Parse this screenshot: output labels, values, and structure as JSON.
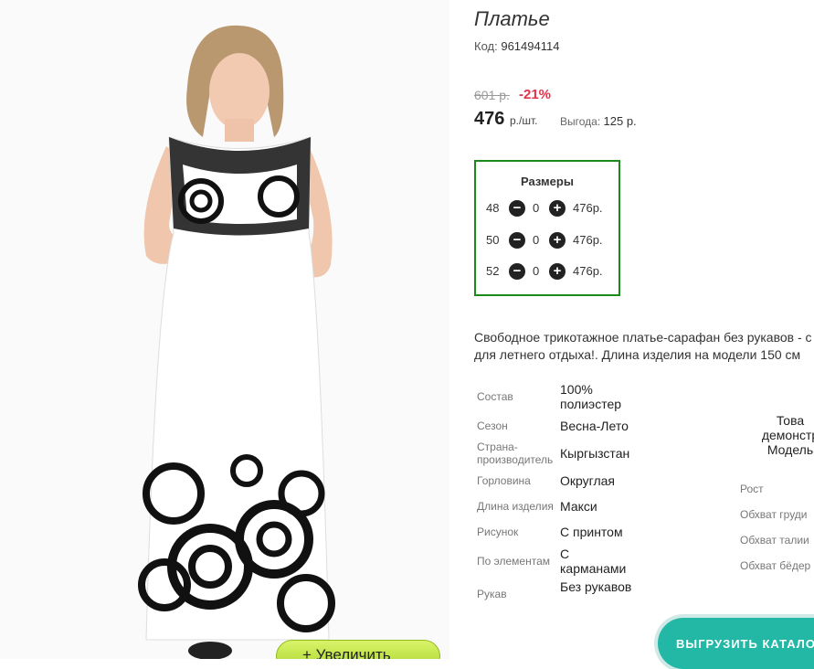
{
  "product": {
    "title": "Платье",
    "code_label": "Код:",
    "code_value": "961494114",
    "old_price": "601 р.",
    "discount": "-21%",
    "price": "476",
    "price_unit": "р./шт.",
    "benefit_label": "Выгода:",
    "benefit_value": "125 р."
  },
  "sizes": {
    "title": "Размеры",
    "rows": [
      {
        "size": "48",
        "qty": "0",
        "price": "476р."
      },
      {
        "size": "50",
        "qty": "0",
        "price": "476р."
      },
      {
        "size": "52",
        "qty": "0",
        "price": "476р."
      }
    ]
  },
  "description": {
    "line1": "Свободное трикотажное платье-сарафан без рукавов - с",
    "line2": "для летнего отдыха!. Длина изделия на модели 150 см"
  },
  "properties": [
    {
      "label": "Состав",
      "value": "100% полиэстер"
    },
    {
      "label": "Сезон",
      "value": "Весна-Лето"
    },
    {
      "label": "Страна-производитель",
      "value": "Кыргызстан"
    },
    {
      "label": "Горловина",
      "value": "Округлая"
    },
    {
      "label": "Длина изделия",
      "value": "Макси"
    },
    {
      "label": "Рисунок",
      "value": "С принтом"
    },
    {
      "label": "По элементам",
      "value": "С карманами"
    },
    {
      "label": "Рукав",
      "value": "Без рукавов"
    }
  ],
  "model": {
    "note_line1": "Това",
    "note_line2": "демонстр",
    "note_line3": "Модель",
    "labels": [
      "Рост",
      "Обхват груди",
      "Обхват талии",
      "Обхват бёдер"
    ]
  },
  "buttons": {
    "zoom": "+  Увеличить",
    "export": "ВЫГРУЗИТЬ  КАТАЛОГ"
  },
  "colors": {
    "accent_green": "#1a8a1a",
    "discount_red": "#e2334a",
    "export_teal": "#23b8a6",
    "zoom_green": "#b8e03a"
  }
}
